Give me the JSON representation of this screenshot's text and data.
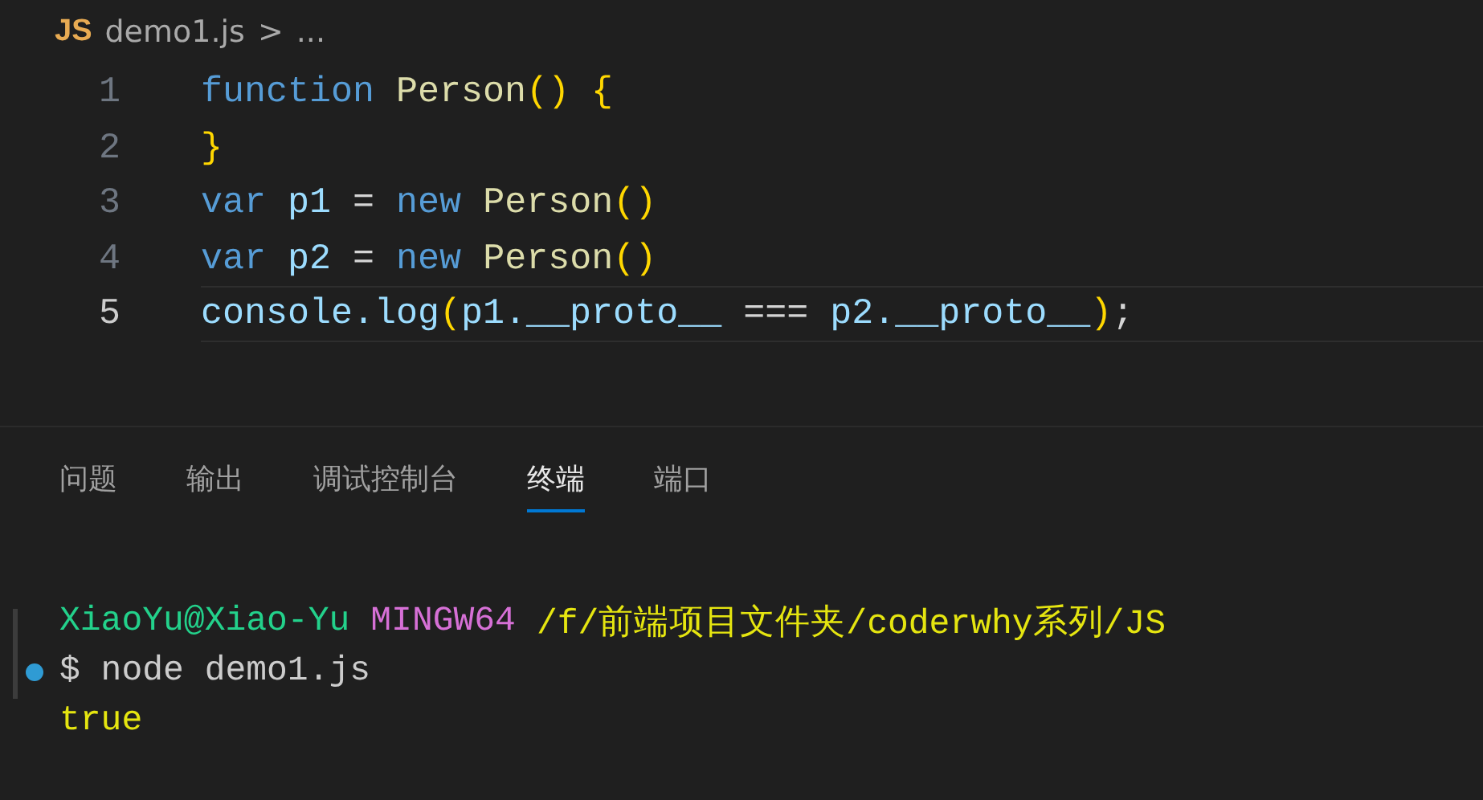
{
  "breadcrumb": {
    "file_icon": "JS",
    "file": "demo1.js",
    "separator": ">",
    "more": "..."
  },
  "editor": {
    "lines": [
      {
        "number": "1",
        "current": false,
        "tokens": [
          {
            "text": "function ",
            "kind": "keyword"
          },
          {
            "text": "Person",
            "kind": "func"
          },
          {
            "text": "() {",
            "kind": "bracket"
          }
        ]
      },
      {
        "number": "2",
        "current": false,
        "tokens": [
          {
            "text": "}",
            "kind": "bracket"
          }
        ]
      },
      {
        "number": "3",
        "current": false,
        "tokens": [
          {
            "text": "var ",
            "kind": "keyword"
          },
          {
            "text": "p1",
            "kind": "variable"
          },
          {
            "text": " = ",
            "kind": "plain"
          },
          {
            "text": "new ",
            "kind": "keyword"
          },
          {
            "text": "Person",
            "kind": "func"
          },
          {
            "text": "()",
            "kind": "bracket"
          }
        ]
      },
      {
        "number": "4",
        "current": false,
        "tokens": [
          {
            "text": "var ",
            "kind": "keyword"
          },
          {
            "text": "p2",
            "kind": "variable"
          },
          {
            "text": " = ",
            "kind": "plain"
          },
          {
            "text": "new ",
            "kind": "keyword"
          },
          {
            "text": "Person",
            "kind": "func"
          },
          {
            "text": "()",
            "kind": "bracket"
          }
        ]
      },
      {
        "number": "5",
        "current": true,
        "tokens": [
          {
            "text": "console.log",
            "kind": "variable"
          },
          {
            "text": "(",
            "kind": "bracket"
          },
          {
            "text": "p1.__proto__",
            "kind": "variable"
          },
          {
            "text": " === ",
            "kind": "plain"
          },
          {
            "text": "p2.__proto__",
            "kind": "variable"
          },
          {
            "text": ")",
            "kind": "bracket"
          },
          {
            "text": ";",
            "kind": "plain"
          }
        ]
      }
    ]
  },
  "panel": {
    "tabs": [
      {
        "label": "问题",
        "selected": false
      },
      {
        "label": "输出",
        "selected": false
      },
      {
        "label": "调试控制台",
        "selected": false
      },
      {
        "label": "终端",
        "selected": true
      },
      {
        "label": "端口",
        "selected": false
      }
    ]
  },
  "terminal": {
    "lines": [
      {
        "kind": "prompt",
        "segments": [
          {
            "text": "XiaoYu@Xiao-Yu",
            "color": "#23d18b"
          },
          {
            "text": "MINGW64",
            "color": "#d670d6"
          },
          {
            "text": "/f/前端项目文件夹/coderwhy系列/JS",
            "color": "#e5e510"
          }
        ]
      },
      {
        "kind": "command",
        "segments": [
          {
            "text": "$ node demo1.js",
            "color": "#cccccc"
          }
        ]
      },
      {
        "kind": "output",
        "segments": [
          {
            "text": "true",
            "color": "#e5e510"
          }
        ]
      }
    ]
  }
}
